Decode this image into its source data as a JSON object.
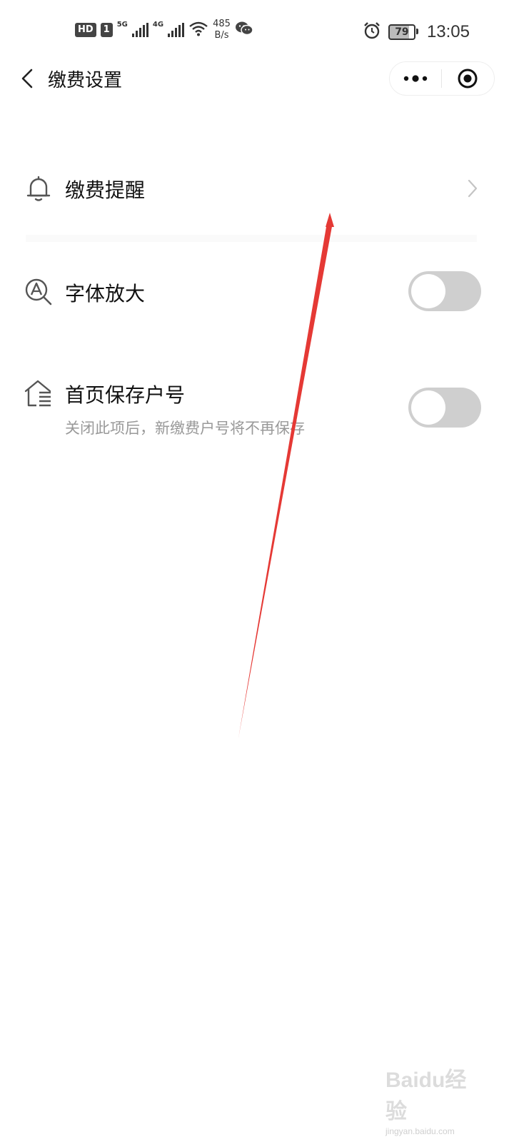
{
  "status_bar": {
    "hd": "HD",
    "sim": "1",
    "net1": "5G",
    "net2": "4G",
    "speed_value": "485",
    "speed_unit": "B/s",
    "battery": "79",
    "time": "13:05",
    "icons": [
      "hd-icon",
      "signal-icon",
      "wifi-icon",
      "wechat-icon",
      "alarm-icon",
      "battery-icon"
    ]
  },
  "nav": {
    "title": "缴费设置",
    "icons": [
      "back-arrow-icon",
      "more-dots-icon",
      "close-target-icon"
    ]
  },
  "settings": {
    "items": [
      {
        "label": "缴费提醒",
        "icon": "bell-icon",
        "control": "chevron"
      },
      {
        "label": "字体放大",
        "icon": "magnify-font-icon",
        "control": "toggle",
        "enabled": false
      },
      {
        "label": "首页保存户号",
        "subtitle": "关闭此项后，新缴费户号将不再保存",
        "icon": "home-list-icon",
        "control": "toggle",
        "enabled": false
      }
    ]
  },
  "watermark": {
    "main": "Baidu经验",
    "sub": "jingyan.baidu.com"
  },
  "colors": {
    "annotation_arrow": "#e53935",
    "toggle_off": "#cfcfcf",
    "text_primary": "#111111",
    "text_secondary": "#999999"
  }
}
